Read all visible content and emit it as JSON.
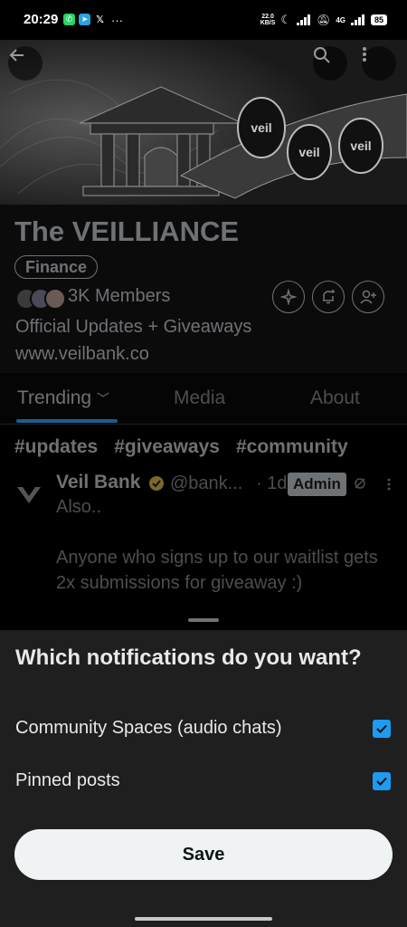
{
  "status": {
    "time": "20:29",
    "net_speed_value": "22.0",
    "net_speed_unit": "KB/S",
    "network": "4G",
    "battery": "85",
    "more": "···"
  },
  "community": {
    "title": "The VEILLIANCE",
    "category": "Finance",
    "members": "3K Members",
    "description": "Official Updates + Giveaways",
    "website": "www.veilbank.co"
  },
  "tabs": [
    {
      "label": "Trending"
    },
    {
      "label": "Media"
    },
    {
      "label": "About"
    }
  ],
  "hashtags": [
    "#updates",
    "#giveaways",
    "#community"
  ],
  "post": {
    "author": "Veil Bank",
    "handle": "@bank...",
    "time": "· 1d",
    "badge": "Admin",
    "text": "Also..\n\nAnyone who signs up to our waitlist gets 2x submissions for giveaway :)"
  },
  "sheet": {
    "title": "Which notifications do you want?",
    "options": [
      {
        "label": "Community Spaces (audio chats)",
        "checked": true
      },
      {
        "label": "Pinned posts",
        "checked": true
      }
    ],
    "save_label": "Save"
  },
  "colors": {
    "accent": "#1d9bf0",
    "sheet_bg": "#1f1f20",
    "save_bg": "#eff3f4"
  }
}
